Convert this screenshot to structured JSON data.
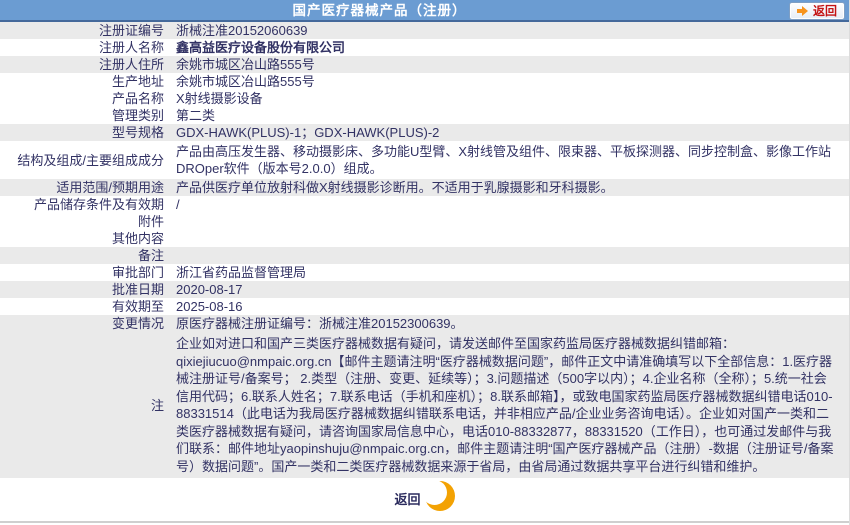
{
  "header": {
    "title": "国产医疗器械产品（注册）",
    "back_button_label": "返回"
  },
  "rows": [
    {
      "label": "注册证编号",
      "value": "浙械注准20152060639"
    },
    {
      "label": "注册人名称",
      "value": "鑫高益医疗设备股份有限公司"
    },
    {
      "label": "注册人住所",
      "value": "余姚市城区冶山路555号"
    },
    {
      "label": "生产地址",
      "value": "余姚市城区冶山路555号"
    },
    {
      "label": "产品名称",
      "value": "X射线摄影设备"
    },
    {
      "label": "管理类别",
      "value": "第二类"
    },
    {
      "label": "型号规格",
      "value": "GDX-HAWK(PLUS)-1；GDX-HAWK(PLUS)-2"
    },
    {
      "label": "结构及组成/主要组成成分",
      "value": "产品由高压发生器、移动摄影床、多功能U型臂、X射线管及组件、限束器、平板探测器、同步控制盒、影像工作站DROper软件（版本号2.0.0）组成。"
    },
    {
      "label": "适用范围/预期用途",
      "value": "产品供医疗单位放射科做X射线摄影诊断用。不适用于乳腺摄影和牙科摄影。"
    },
    {
      "label": "产品储存条件及有效期",
      "value": "/"
    },
    {
      "label": "附件",
      "value": ""
    },
    {
      "label": "其他内容",
      "value": ""
    },
    {
      "label": "备注",
      "value": ""
    },
    {
      "label": "审批部门",
      "value": "浙江省药品监督管理局"
    },
    {
      "label": "批准日期",
      "value": "2020-08-17"
    },
    {
      "label": "有效期至",
      "value": "2025-08-16"
    },
    {
      "label": "变更情况",
      "value": "原医疗器械注册证编号：浙械注准20152300639。"
    },
    {
      "label": "注",
      "value": "企业如对进口和国产三类医疗器械数据有疑问，请发送邮件至国家药监局医疗器械数据纠错邮箱：qixiejiucuo@nmpaic.org.cn【邮件主题请注明“医疗器械数据问题”，邮件正文中请准确填写以下全部信息：1.医疗器械注册证号/备案号； 2.类型（注册、变更、延续等）；3.问题描述（500字以内）；4.企业名称（全称）；5.统一社会信用代码；6.联系人姓名；7.联系电话（手机和座机）；8.联系邮箱】，或致电国家药监局医疗器械数据纠错电话010-88331514（此电话为我局医疗器械数据纠错联系电话，并非相应产品/企业业务咨询电话）。企业如对国产一类和二类医疗器械数据有疑问，请咨询国家局信息中心，电话010-88332877，88331520（工作日），也可通过发邮件与我们联系：邮件地址yaopinshuju@nmpaic.org.cn，邮件主题请注明“国产医疗器械产品（注册）-数据（注册证号/备案号）数据问题”。国产一类和二类医疗器械数据来源于省局，由省局通过数据共享平台进行纠错和维护。"
    }
  ],
  "footer": {
    "return_button_label": "返回"
  },
  "colors": {
    "header_blue": "#6b9cd2",
    "header_border": "#44699b",
    "stripe_gray": "#eaeaea",
    "text_navy": "#323264",
    "accent_orange": "#f7941d",
    "button_red": "#c41414"
  }
}
